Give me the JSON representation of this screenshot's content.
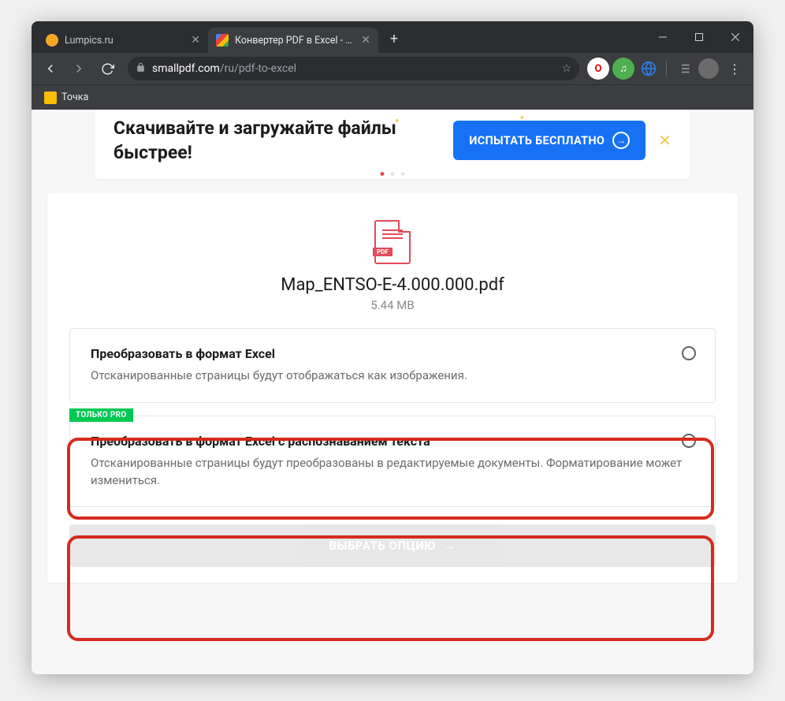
{
  "browser": {
    "tabs": [
      {
        "title": "Lumpics.ru"
      },
      {
        "title": "Конвертер PDF в Excel - беспла"
      }
    ],
    "url": {
      "domain": "smallpdf.com",
      "path": "/ru/pdf-to-excel"
    },
    "bookmark": "Точка"
  },
  "banner": {
    "title_l1": "Скачивайте и загружайте файлы",
    "title_l2": "быстрее!",
    "cta": "ИСПЫТАТЬ БЕСПЛАТНО"
  },
  "file": {
    "name": "Map_ENTSO-E-4.000.000.pdf",
    "size": "5.44 MB",
    "badge": "PDF"
  },
  "options": [
    {
      "title": "Преобразовать в формат Excel",
      "desc": "Отсканированные страницы будут отображаться как изображения."
    },
    {
      "title": "Преобразовать в формат Excel с распознаванием текста",
      "desc": "Отсканированные страницы будут преобразованы в редактируемые документы. Форматирование может измениться.",
      "pro": "ТОЛЬКО PRO"
    }
  ],
  "choose_button": "ВЫБРАТЬ ОПЦИЮ"
}
